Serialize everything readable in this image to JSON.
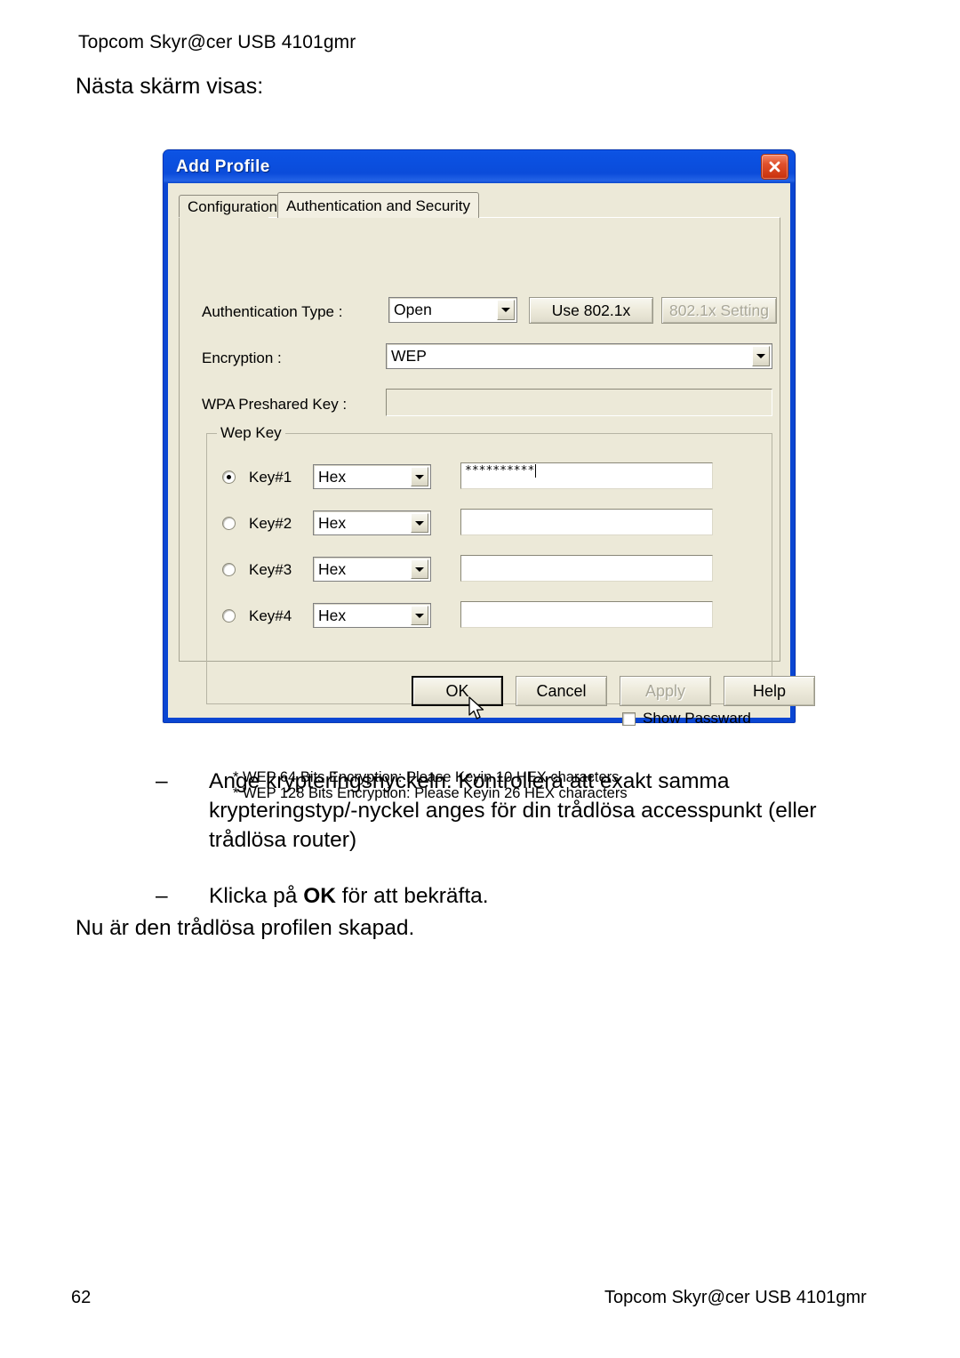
{
  "page": {
    "header": "Topcom Skyr@cer USB 4101gmr",
    "intro": "Nästa skärm visas:",
    "closing": "Nu är den trådlösa profilen skapad.",
    "footer_page_number": "62",
    "footer_title": "Topcom Skyr@cer USB 4101gmr",
    "bullets": [
      {
        "marker": "–",
        "text_before": "Ange krypteringsnyckeln. Kontrollera att exakt samma krypteringstyp/-nyckel anges för din trådlösa accesspunkt (eller trådlösa router)",
        "bold": "",
        "text_after": ""
      },
      {
        "marker": "–",
        "text_before": "Klicka på ",
        "bold": "OK",
        "text_after": " för att bekräfta."
      }
    ]
  },
  "dialog": {
    "title": "Add Profile",
    "close_icon": "close-icon",
    "colors": {
      "titlebar": "#0b4fdf",
      "body": "#ece9d8",
      "close_button": "#d93f14",
      "border": "#0a46d2"
    },
    "tabs": [
      {
        "label": "Configuration",
        "active": false
      },
      {
        "label": "Authentication and Security",
        "active": true
      }
    ],
    "fields": {
      "auth_type_label": "Authentication Type :",
      "auth_type_value": "Open",
      "use_8021x_button": "Use 802.1x",
      "setting_8021x_button": "802.1x Setting",
      "encryption_label": "Encryption :",
      "encryption_value": "WEP",
      "wpa_preshared_label": "WPA Preshared Key :",
      "wpa_preshared_value": ""
    },
    "wep_key_group": {
      "title": "Wep Key",
      "rows": [
        {
          "label": "Key#1",
          "selected": true,
          "format": "Hex",
          "value": "**********"
        },
        {
          "label": "Key#2",
          "selected": false,
          "format": "Hex",
          "value": ""
        },
        {
          "label": "Key#3",
          "selected": false,
          "format": "Hex",
          "value": ""
        },
        {
          "label": "Key#4",
          "selected": false,
          "format": "Hex",
          "value": ""
        }
      ],
      "note_line_1": "* WEP 64 Bits Encryption:    Please Keyin 10 HEX characters",
      "note_line_2": "* WEP 128 Bits Encryption:   Please Keyin 26 HEX characters"
    },
    "show_password": {
      "label": "Show Passward",
      "checked": false
    },
    "buttons": [
      {
        "label": "OK",
        "default": true,
        "disabled": false
      },
      {
        "label": "Cancel",
        "default": false,
        "disabled": false
      },
      {
        "label": "Apply",
        "default": false,
        "disabled": true
      },
      {
        "label": "Help",
        "default": false,
        "disabled": false
      }
    ]
  }
}
